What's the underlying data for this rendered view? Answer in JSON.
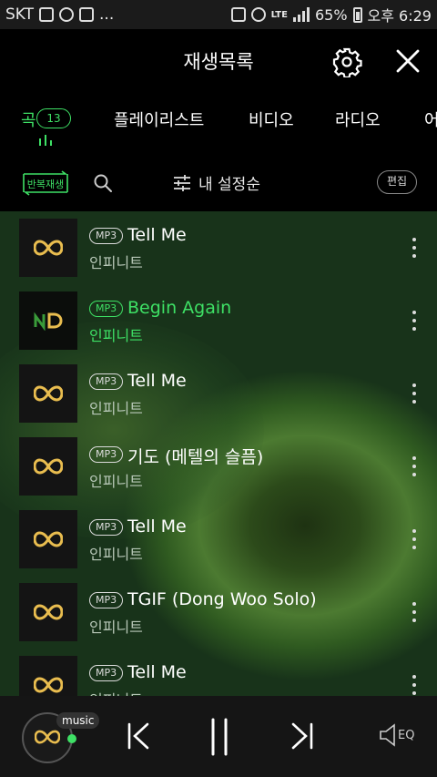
{
  "status_bar": {
    "carrier": "SKT",
    "dots": "...",
    "lte": "LTE",
    "battery": "65%",
    "time": "오후 6:29"
  },
  "header": {
    "title": "재생목록",
    "settings_icon": "gear-icon",
    "close_icon": "close-icon"
  },
  "tabs": {
    "items": [
      {
        "label": "곡",
        "count": "13",
        "active": true
      },
      {
        "label": "플레이리스트"
      },
      {
        "label": "비디오"
      },
      {
        "label": "라디오"
      },
      {
        "label": "어"
      }
    ]
  },
  "toolbar": {
    "repeat_label": "반복재생",
    "sort_label": "내 설정순",
    "edit_label": "편집"
  },
  "accent_color": "#3ee065",
  "playlist": [
    {
      "format": "MP3",
      "title": "Tell Me",
      "artist": "인피니트",
      "playing": false
    },
    {
      "format": "MP3",
      "title": "Begin Again",
      "artist": "인피니트",
      "playing": true
    },
    {
      "format": "MP3",
      "title": "Tell Me",
      "artist": "인피니트",
      "playing": false
    },
    {
      "format": "MP3",
      "title": "기도 (메텔의 슬픔)",
      "artist": "인피니트",
      "playing": false
    },
    {
      "format": "MP3",
      "title": "Tell Me",
      "artist": "인피니트",
      "playing": false
    },
    {
      "format": "MP3",
      "title": "TGIF (Dong Woo Solo)",
      "artist": "인피니트",
      "playing": false
    },
    {
      "format": "MP3",
      "title": "Tell Me",
      "artist": "인피니트",
      "playing": false
    }
  ],
  "player": {
    "source_tag": "music",
    "eq_label": "EQ"
  }
}
